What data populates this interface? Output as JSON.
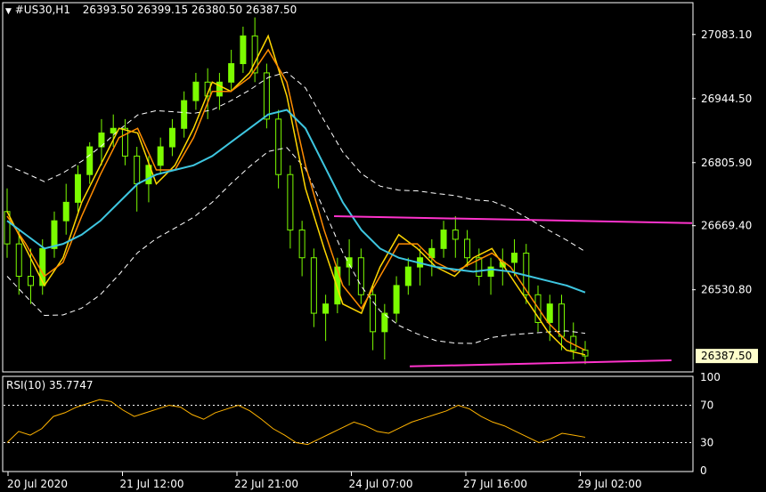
{
  "header": {
    "symbol_timeframe": "#US30,H1",
    "ohlc": "26393.50 26399.15 26380.50 26387.50"
  },
  "rsi_header": "RSI(10) 35.7747",
  "colors": {
    "background": "#000000",
    "candle": "#7CFC00",
    "ma_fast": "#FFD700",
    "ma_mid": "#FF8C00",
    "ma_slow": "#3EC6E0",
    "bands": "#FFFFFF",
    "trendline": "#FF33CC",
    "rsi_line": "#FFB300",
    "price_marker_bg": "#FFFFCC"
  },
  "chart_data": [
    {
      "type": "line",
      "title": "#US30,H1",
      "x": [
        "20 Jul 2020",
        "21 Jul 12:00",
        "22 Jul 21:00",
        "24 Jul 07:00",
        "27 Jul 16:00",
        "29 Jul 02:00"
      ],
      "y_ticks": [
        27083.1,
        26944.5,
        26805.9,
        26669.4,
        26530.8
      ],
      "ylim": [
        26355,
        27150
      ],
      "last_price": "26387.50",
      "series": [
        {
          "values": [
            26700,
            26620,
            26540,
            26600,
            26720,
            26800,
            26880,
            26870,
            26760,
            26800,
            26880,
            26980,
            26960,
            27000,
            27080,
            26950,
            26750,
            26620,
            26500,
            26480,
            26580,
            26650,
            26620,
            26580,
            26560,
            26600,
            26620,
            26560,
            26500,
            26440,
            26400,
            26390
          ]
        },
        {
          "values": [
            26690,
            26630,
            26560,
            26590,
            26690,
            26780,
            26860,
            26880,
            26790,
            26790,
            26860,
            26960,
            26960,
            26990,
            27050,
            26980,
            26800,
            26660,
            26540,
            26490,
            26560,
            26630,
            26630,
            26590,
            26570,
            26590,
            26610,
            26580,
            26520,
            26460,
            26420,
            26400
          ]
        },
        {
          "values": [
            26680,
            26650,
            26620,
            26630,
            26650,
            26680,
            26720,
            26760,
            26780,
            26790,
            26800,
            26820,
            26850,
            26880,
            26910,
            26920,
            26880,
            26800,
            26720,
            26660,
            26620,
            26600,
            26590,
            26580,
            26575,
            26570,
            26575,
            26570,
            26560,
            26550,
            26540,
            26525
          ]
        }
      ],
      "candles": [
        [
          26700,
          26750,
          26600,
          26630
        ],
        [
          26630,
          26660,
          26520,
          26560
        ],
        [
          26560,
          26620,
          26500,
          26540
        ],
        [
          26540,
          26640,
          26520,
          26620
        ],
        [
          26620,
          26700,
          26600,
          26680
        ],
        [
          26680,
          26760,
          26650,
          26720
        ],
        [
          26720,
          26800,
          26700,
          26780
        ],
        [
          26780,
          26850,
          26760,
          26840
        ],
        [
          26840,
          26900,
          26800,
          26870
        ],
        [
          26870,
          26910,
          26840,
          26880
        ],
        [
          26880,
          26900,
          26800,
          26820
        ],
        [
          26820,
          26840,
          26700,
          26760
        ],
        [
          26760,
          26820,
          26720,
          26800
        ],
        [
          26800,
          26860,
          26780,
          26840
        ],
        [
          26840,
          26900,
          26820,
          26880
        ],
        [
          26880,
          26960,
          26860,
          26940
        ],
        [
          26940,
          27000,
          26920,
          26980
        ],
        [
          26980,
          27010,
          26900,
          26950
        ],
        [
          26950,
          27000,
          26920,
          26980
        ],
        [
          26980,
          27050,
          26960,
          27020
        ],
        [
          27020,
          27100,
          27000,
          27080
        ],
        [
          27080,
          27120,
          26980,
          27000
        ],
        [
          27000,
          27020,
          26880,
          26900
        ],
        [
          26900,
          26920,
          26750,
          26780
        ],
        [
          26780,
          26800,
          26620,
          26660
        ],
        [
          26660,
          26680,
          26560,
          26600
        ],
        [
          26600,
          26620,
          26450,
          26480
        ],
        [
          26480,
          26520,
          26420,
          26500
        ],
        [
          26500,
          26600,
          26480,
          26580
        ],
        [
          26580,
          26640,
          26540,
          26600
        ],
        [
          26600,
          26620,
          26500,
          26520
        ],
        [
          26520,
          26540,
          26400,
          26440
        ],
        [
          26440,
          26500,
          26380,
          26480
        ],
        [
          26480,
          26560,
          26460,
          26540
        ],
        [
          26540,
          26600,
          26520,
          26580
        ],
        [
          26580,
          26620,
          26540,
          26600
        ],
        [
          26600,
          26640,
          26560,
          26620
        ],
        [
          26620,
          26680,
          26600,
          26660
        ],
        [
          26660,
          26690,
          26600,
          26640
        ],
        [
          26640,
          26660,
          26580,
          26600
        ],
        [
          26600,
          26620,
          26540,
          26560
        ],
        [
          26560,
          26600,
          26520,
          26580
        ],
        [
          26580,
          26620,
          26540,
          26590
        ],
        [
          26590,
          26640,
          26560,
          26610
        ],
        [
          26610,
          26630,
          26500,
          26520
        ],
        [
          26520,
          26540,
          26440,
          26460
        ],
        [
          26460,
          26520,
          26420,
          26500
        ],
        [
          26500,
          26520,
          26400,
          26430
        ],
        [
          26430,
          26460,
          26380,
          26400
        ],
        [
          26400,
          26420,
          26370,
          26387.5
        ]
      ],
      "upper_trendline": [
        [
          0.48,
          26690
        ],
        [
          1.0,
          26675
        ]
      ],
      "lower_trendline": [
        [
          0.59,
          26365
        ],
        [
          0.97,
          26378
        ]
      ]
    },
    {
      "type": "line",
      "title": "RSI(10) 35.7747",
      "y_ticks": [
        100,
        70,
        30,
        0
      ],
      "ylim": [
        0,
        100
      ],
      "levels": [
        70,
        30
      ],
      "values": [
        30,
        42,
        38,
        45,
        58,
        62,
        68,
        72,
        76,
        74,
        65,
        58,
        62,
        66,
        70,
        68,
        60,
        55,
        62,
        66,
        70,
        64,
        55,
        45,
        38,
        30,
        28,
        34,
        40,
        46,
        52,
        48,
        42,
        40,
        46,
        52,
        56,
        60,
        64,
        70,
        66,
        58,
        52,
        48,
        42,
        36,
        30,
        34,
        40,
        38,
        35.7747
      ]
    }
  ]
}
